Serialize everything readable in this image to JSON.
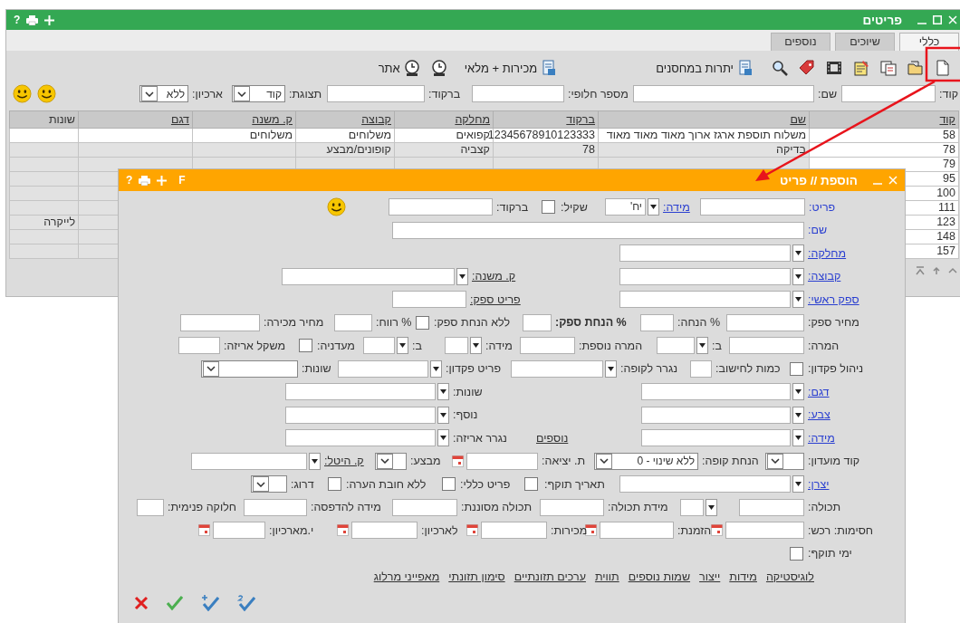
{
  "window": {
    "title": "פריטים",
    "help": "?"
  },
  "tabs": [
    {
      "label": "כללי",
      "selected": true
    },
    {
      "label": "שיוכים",
      "selected": false
    },
    {
      "label": "נוספים",
      "selected": false
    }
  ],
  "toolbar": {
    "buttons": [
      "יתרות במחסנים",
      "מכירות + מלאי",
      "אתר"
    ]
  },
  "filters": [
    {
      "kind": "label",
      "text": "קוד:"
    },
    {
      "kind": "field"
    },
    {
      "kind": "label",
      "text": "שם:"
    },
    {
      "kind": "field"
    },
    {
      "kind": "label",
      "text": "מספר חלופי:"
    },
    {
      "kind": "field"
    },
    {
      "kind": "label",
      "text": "ברקוד:"
    },
    {
      "kind": "field"
    },
    {
      "kind": "label",
      "text": "תצוגת:"
    },
    {
      "kind": "select",
      "value": "קוד"
    },
    {
      "kind": "label",
      "text": "ארכיון:"
    },
    {
      "kind": "select",
      "value": "ללא"
    },
    {
      "kind": "smiley"
    },
    {
      "kind": "smiley"
    }
  ],
  "table": {
    "columns": [
      {
        "label": "קוד",
        "sortable": true
      },
      {
        "label": "שם",
        "sortable": true
      },
      {
        "label": "ברקוד",
        "sortable": true
      },
      {
        "label": "מחלקה",
        "sortable": true
      },
      {
        "label": "קבוצה",
        "sortable": true
      },
      {
        "label": "ק. משנה",
        "sortable": true
      },
      {
        "label": "דגם",
        "sortable": true
      },
      {
        "label": "שונות",
        "sortable": false
      }
    ],
    "rows": [
      {
        "code": "58",
        "name": "משלוח תוספת ארגז ארוך מאוד מאוד מאוד",
        "barcode": "12345678910123333",
        "department": "קפואים",
        "group": "משלוחים",
        "subgroup": "משלוחים"
      },
      {
        "code": "78",
        "name": "בדיקה",
        "barcode": "78",
        "department": "קצביה",
        "group": "קופונים/מבצע"
      },
      {
        "code": "79"
      },
      {
        "code": "95"
      },
      {
        "code": "100"
      },
      {
        "code": "111"
      },
      {
        "code": "123",
        "misc": "לייקרה"
      },
      {
        "code": "148"
      },
      {
        "code": "157"
      }
    ]
  },
  "dialog": {
    "title": "הוספת // פריט",
    "help": "?",
    "f_key": "F",
    "rows": [
      {
        "items": [
          {
            "kind": "accent",
            "text": "פריט:"
          },
          {
            "kind": "field"
          },
          {
            "kind": "link",
            "text": "מידה:"
          },
          {
            "kind": "combo",
            "value": "יח'"
          },
          {
            "kind": "label",
            "text": "שקיל:"
          },
          {
            "kind": "check",
            "checked": false
          },
          {
            "kind": "label",
            "text": "ברקוד:"
          },
          {
            "kind": "field"
          },
          {
            "kind": "smiley"
          }
        ]
      },
      {
        "items": [
          {
            "kind": "accent",
            "text": "שם:"
          },
          {
            "kind": "field"
          }
        ]
      },
      {
        "items": [
          {
            "kind": "link",
            "text": "מחלקה:"
          },
          {
            "kind": "combo"
          }
        ]
      },
      {
        "items": [
          {
            "kind": "link",
            "text": "קבוצה:"
          },
          {
            "kind": "combo"
          },
          {
            "kind": "ulabel",
            "text": "ק. משנה:"
          },
          {
            "kind": "combo"
          }
        ]
      },
      {
        "items": [
          {
            "kind": "link",
            "text": "ספק ראשי:"
          },
          {
            "kind": "combo"
          },
          {
            "kind": "ulabel",
            "text": "פריט ספק:"
          },
          {
            "kind": "field"
          }
        ]
      },
      {
        "items": [
          {
            "kind": "label",
            "text": "מחיר ספק:"
          },
          {
            "kind": "field"
          },
          {
            "kind": "label",
            "text": "% הנחה:"
          },
          {
            "kind": "field"
          },
          {
            "kind": "bold",
            "text": "% הנחת ספק:"
          },
          {
            "kind": "field"
          },
          {
            "kind": "label",
            "text": "ללא הנחת ספק:"
          },
          {
            "kind": "check",
            "checked": false
          },
          {
            "kind": "label",
            "text": "% רווח:"
          },
          {
            "kind": "field"
          },
          {
            "kind": "label",
            "text": "מחיר מכירה:"
          },
          {
            "kind": "field"
          }
        ]
      },
      {
        "items": [
          {
            "kind": "label",
            "text": "המרה:"
          },
          {
            "kind": "field"
          },
          {
            "kind": "label",
            "text": "ב:"
          },
          {
            "kind": "combo"
          },
          {
            "kind": "label",
            "text": "המרה נוספת:"
          },
          {
            "kind": "field"
          },
          {
            "kind": "label",
            "text": "מידה:"
          },
          {
            "kind": "combo"
          },
          {
            "kind": "label",
            "text": "ב:"
          },
          {
            "kind": "combo"
          },
          {
            "kind": "label",
            "text": "מעדניה:"
          },
          {
            "kind": "check",
            "checked": false
          },
          {
            "kind": "label",
            "text": "משקל אריזה:"
          },
          {
            "kind": "field"
          }
        ]
      },
      {
        "items": [
          {
            "kind": "label",
            "text": "ניהול פקדון:"
          },
          {
            "kind": "check",
            "checked": false
          },
          {
            "kind": "label",
            "text": "כמות לחישוב:"
          },
          {
            "kind": "field"
          },
          {
            "kind": "label",
            "text": "נגרר לקופה:"
          },
          {
            "kind": "combo"
          },
          {
            "kind": "label",
            "text": "פריט פקדון:"
          },
          {
            "kind": "combo"
          },
          {
            "kind": "label",
            "text": "שונות:"
          },
          {
            "kind": "select"
          }
        ]
      },
      {
        "items": [
          {
            "kind": "link",
            "text": "דגם:"
          },
          {
            "kind": "combo"
          },
          {
            "kind": "label",
            "text": "שונות:"
          },
          {
            "kind": "combo"
          }
        ]
      },
      {
        "items": [
          {
            "kind": "link",
            "text": "צבע:"
          },
          {
            "kind": "combo"
          },
          {
            "kind": "label",
            "text": "נוסף:"
          },
          {
            "kind": "combo"
          }
        ]
      },
      {
        "items": [
          {
            "kind": "link",
            "text": "מידה:"
          },
          {
            "kind": "combo"
          },
          {
            "kind": "label",
            "text": "נגרר אריזה:"
          },
          {
            "kind": "combo"
          }
        ]
      },
      {
        "items": [
          {
            "kind": "label",
            "text": "קוד מועדון:"
          },
          {
            "kind": "select"
          },
          {
            "kind": "label",
            "text": "הנחת קופה:"
          },
          {
            "kind": "select",
            "value": "ללא שינוי - 0"
          },
          {
            "kind": "label",
            "text": "ת. יציאה:"
          },
          {
            "kind": "date"
          },
          {
            "kind": "label",
            "text": "מבצע:"
          },
          {
            "kind": "select"
          },
          {
            "kind": "ulabel",
            "text": "ק. היטל:"
          },
          {
            "kind": "combo"
          }
        ]
      },
      {
        "items": [
          {
            "kind": "link",
            "text": "יצרן:"
          },
          {
            "kind": "combo"
          },
          {
            "kind": "label",
            "text": "תאריך תוקף:"
          },
          {
            "kind": "check",
            "checked": false
          },
          {
            "kind": "label",
            "text": "פריט כללי:"
          },
          {
            "kind": "check",
            "checked": false
          },
          {
            "kind": "label",
            "text": "ללא חובת הערה:"
          },
          {
            "kind": "check",
            "checked": false
          },
          {
            "kind": "label",
            "text": "דרוג:"
          },
          {
            "kind": "select"
          }
        ]
      },
      {
        "items": [
          {
            "kind": "label",
            "text": "תכולה:"
          },
          {
            "kind": "field"
          },
          {
            "kind": "combo"
          },
          {
            "kind": "label",
            "text": "מידת תכולה:"
          },
          {
            "kind": "field"
          },
          {
            "kind": "label",
            "text": "תכולה מסוננת:"
          },
          {
            "kind": "field"
          },
          {
            "kind": "label",
            "text": "מידה להדפסה:"
          },
          {
            "kind": "field"
          },
          {
            "kind": "label",
            "text": "חלוקה פנימית:"
          },
          {
            "kind": "field"
          }
        ]
      },
      {
        "items": [
          {
            "kind": "label",
            "text": "חסימות: רכש:"
          },
          {
            "kind": "date"
          },
          {
            "kind": "label",
            "text": "הזמנת:"
          },
          {
            "kind": "date"
          },
          {
            "kind": "label",
            "text": "מכירות:"
          },
          {
            "kind": "date"
          },
          {
            "kind": "label",
            "text": "לארכיון:"
          },
          {
            "kind": "date"
          },
          {
            "kind": "label",
            "text": "י.מארכיון:"
          },
          {
            "kind": "date"
          }
        ]
      },
      {
        "items": [
          {
            "kind": "label",
            "text": "ימי תוקף:"
          },
          {
            "kind": "check",
            "checked": false
          }
        ]
      }
    ],
    "extras_link": "נוספים",
    "links": [
      "לוגיסטיקה",
      "מידות",
      "ייצור",
      "שמות נוספים",
      "תווית",
      "ערכים תזונתיים",
      "סימון תזונתי",
      "מאפייני מרלוג"
    ]
  }
}
